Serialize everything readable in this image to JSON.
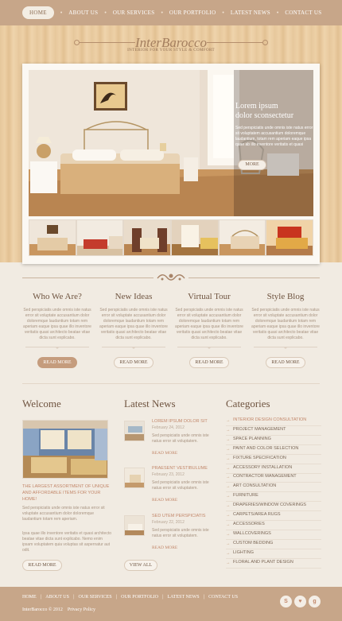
{
  "nav": {
    "items": [
      "HOME",
      "ABOUT US",
      "OUR SERVICES",
      "OUR PORTFOLIO",
      "LATEST NEWS",
      "CONTACT US"
    ],
    "active": "HOME"
  },
  "brand": {
    "logo": "InterBarocco",
    "tagline": "INTERIOR FOR YOUR STYLE & COMFORT"
  },
  "slider": {
    "caption_title_1": "Lorem ipsum",
    "caption_title_2": "dolor sconsectetur",
    "caption_text": "Sed perspiciatis unde omnis iste natus error sit voluptatem accusantium doloremque laudantium, totam rem aperiam eaque ipsa quae ab illo inventore veritatis et quasi architecto beatae vitae dicta sunt explicabo. Nemo enim ipsam voluptatem quia voluptas sit aspernatur aut odit aut fugit, sed quia consequuntur magni aliquam",
    "more_label": "MORE"
  },
  "features": [
    {
      "title": "Who We Are?",
      "text": "Sed perspiciatis unde omnis iste natus error sit voluptate accusantium dolor doloremque laudantium totam rem aperiam eaque ipsa quae illo inventore veritatis quasi architecto beatae vitae dicta sunt explicabo.",
      "button": "READ MORE"
    },
    {
      "title": "New Ideas",
      "text": "Sed perspiciatis unde omnis iste natus error sit voluptate accusantium dolor doloremque laudantium totam rem aperiam eaque ipsa quae illo inventore veritatis quasi architecto beatae vitae dicta sunt explicabo.",
      "button": "READ MORE"
    },
    {
      "title": "Virtual Tour",
      "text": "Sed perspiciatis unde omnis iste natus error sit voluptate accusantium dolor doloremque laudantium totam rem aperiam eaque ipsa quae illo inventore veritatis quasi architecto beatae vitae dicta sunt explicabo.",
      "button": "READ MORE"
    },
    {
      "title": "Style Blog",
      "text": "Sed perspiciatis unde omnis iste natus error sit voluptate accusantium dolor doloremque laudantium totam rem aperiam eaque ipsa quae illo inventore veritatis quasi architecto beatae vitae dicta sunt explicabo.",
      "button": "READ MORE"
    }
  ],
  "welcome": {
    "title": "Welcome",
    "headline": "THE LARGEST ASSORTMENT OF UNIQUE AND AFFORDABLE ITEMS FOR YOUR HOME!",
    "text_1": "Sed perspiciatis unde omnis iste natus error sit voluptate accusantium dolor doloremque laudantium totam rem aperiam.",
    "text_2": "Ipsa quae illo inventore veritatis et quasi architecto beatae vitae dicta sunt explicabo. Nemo enim ipsam voluptatem quia voluptas sit aspernatur aut odit.",
    "button": "READ MORE"
  },
  "news": {
    "title": "Latest News",
    "items": [
      {
        "title": "LOREM IPSUM DOLOR SIT",
        "date": "February 24, 2012",
        "text": "Sed perspiciatis unde omnis iste natus error sit voluptatem.",
        "more": "READ MORE"
      },
      {
        "title": "PRAESENT VESTIBULUME",
        "date": "February 23, 2012",
        "text": "Sed perspiciatis unde omnis iste natus error sit voluptatem.",
        "more": "READ MORE"
      },
      {
        "title": "SED UTEM PERSPICIATIS",
        "date": "February 22, 2012",
        "text": "Sed perspiciatis unde omnis iste natus error sit voluptatem.",
        "more": "READ MORE"
      }
    ],
    "button": "VIEW ALL"
  },
  "categories": {
    "title": "Categories",
    "items": [
      "INTERIOR DESIGN CONSULTATION",
      "PROJECT MANAGEMENT",
      "SPACE PLANNING",
      "PAINT AND COLOR SELECTION",
      "FIXTURE SPECIFICATION",
      "ACCESSORY INSTALLATION",
      "CONTRACTOR MANAGEMENT",
      "ART CONSULTATION",
      "FURNITURE",
      "DRAPERIES/WINDOW COVERINGS",
      "CARPETS/AREA RUGS",
      "ACCESSORIES",
      "WALLCOVERINGS",
      "CUSTOM BEDDING",
      "LIGHTING",
      "FLORAL AND PLANT DESIGN"
    ]
  },
  "footer": {
    "nav": [
      "HOME",
      "ABOUT US",
      "OUR SERVICES",
      "OUR PORTFOLIO",
      "LATEST NEWS",
      "CONTACT US"
    ],
    "copyright": "InterBarocco © 2012",
    "privacy": "Privacy Policy",
    "social_icons": [
      "skype-icon",
      "heart-icon",
      "google-plus-icon"
    ]
  },
  "colors": {
    "accent": "#c7a689",
    "link": "#c2876a",
    "background": "#f1ebe2"
  }
}
